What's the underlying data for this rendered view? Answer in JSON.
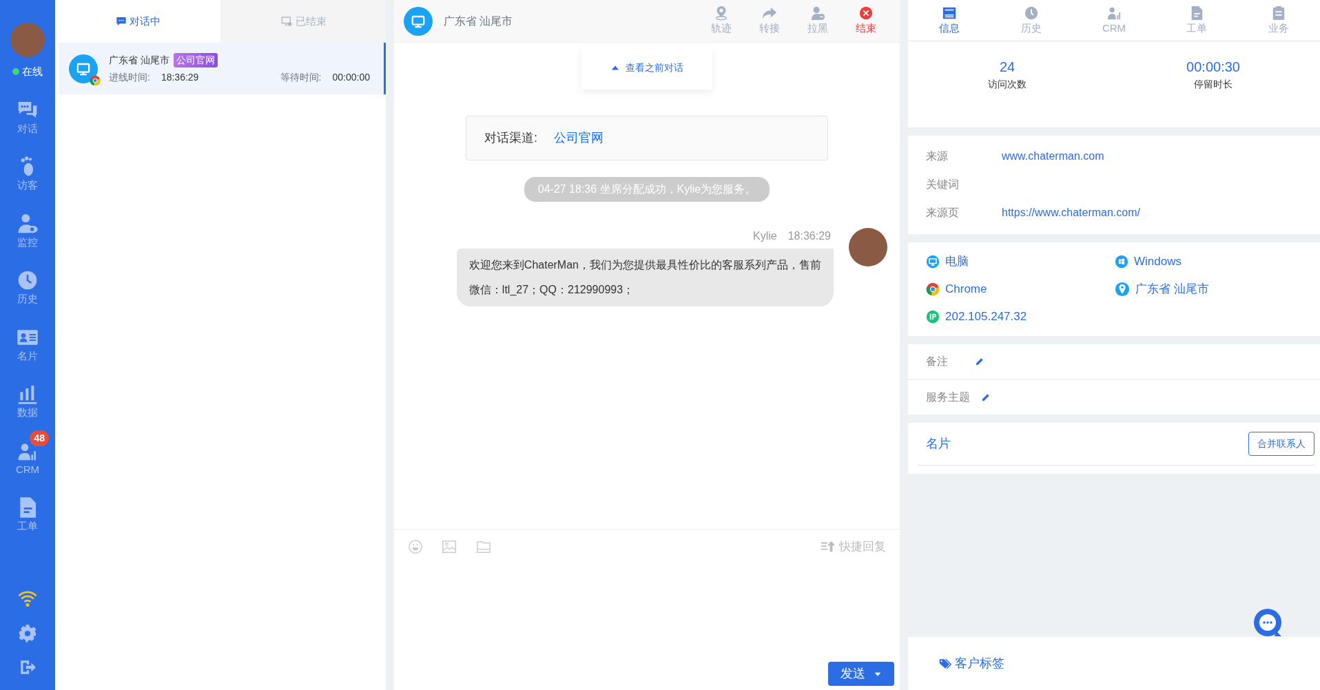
{
  "agent": {
    "status": "在线",
    "online": true
  },
  "nav": [
    {
      "label": "对话"
    },
    {
      "label": "访客"
    },
    {
      "label": "监控"
    },
    {
      "label": "历史"
    },
    {
      "label": "名片"
    },
    {
      "label": "数据"
    },
    {
      "label": "CRM",
      "badge": "48"
    },
    {
      "label": "工单"
    }
  ],
  "list_tabs": [
    {
      "label": "对话中",
      "selected": true
    },
    {
      "label": "已结束",
      "selected": false
    }
  ],
  "conversations": [
    {
      "title": "广东省 汕尾市",
      "tag": "公司官网",
      "entry_label": "进线时间:",
      "entry_time": "18:36:29",
      "wait_label": "等待时间:",
      "wait_time": "00:00:00",
      "selected": true
    }
  ],
  "chat": {
    "title": "广东省 汕尾市",
    "actions": [
      {
        "label": "轨迹",
        "kind": "normal"
      },
      {
        "label": "转接",
        "kind": "normal"
      },
      {
        "label": "拉黑",
        "kind": "normal"
      },
      {
        "label": "结束",
        "kind": "danger"
      }
    ],
    "load_previous": "查看之前对话",
    "channel": {
      "label": "对话渠道:",
      "value": "公司官网"
    },
    "system_message": "04-27 18:36 坐席分配成功，Kylie为您服务。",
    "messages": [
      {
        "sender": "Kylie",
        "time": "18:36:29",
        "lines": [
          "欢迎您来到ChaterMan，我们为您提供最具性价比的客服系列产品，售前",
          "微信：ltl_27；QQ：212990993；"
        ]
      }
    ],
    "quick_reply": "快捷回复",
    "send": "发送"
  },
  "info_tabs": [
    {
      "label": "信息",
      "selected": true
    },
    {
      "label": "历史",
      "selected": false
    },
    {
      "label": "CRM",
      "selected": false
    },
    {
      "label": "工单",
      "selected": false
    },
    {
      "label": "业务",
      "selected": false
    }
  ],
  "stats": [
    {
      "value": "24",
      "label": "访问次数"
    },
    {
      "value": "00:00:30",
      "label": "停留时长"
    }
  ],
  "source_fields": [
    {
      "label": "来源",
      "value": "www.chaterman.com"
    },
    {
      "label": "关键词"
    },
    {
      "label": "来源页",
      "value": "https://www.chaterman.com/"
    }
  ],
  "device": {
    "type": "电脑",
    "os": "Windows",
    "browser": "Chrome",
    "location": "广东省 汕尾市",
    "ip": "202.105.247.32"
  },
  "notes": [
    {
      "label": "备注"
    },
    {
      "label": "服务主题"
    }
  ],
  "card": {
    "title": "名片",
    "button": "合并联系人"
  },
  "tags": {
    "label": "客户标签"
  }
}
